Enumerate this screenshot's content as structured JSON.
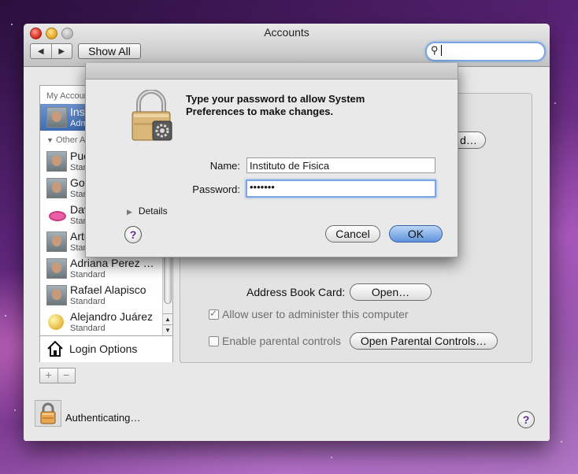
{
  "window": {
    "title": "Accounts"
  },
  "toolbar": {
    "back_icon": "◀",
    "forward_icon": "▶",
    "show_all_label": "Show All",
    "search_placeholder": ""
  },
  "sidebar": {
    "my_account_header": "My Account",
    "other_accounts_header": "Other Accou",
    "accounts": [
      {
        "name": "Instituto",
        "role": "Admin",
        "selected": true,
        "avatar": "face"
      },
      {
        "name": "Puente",
        "role": "Standard",
        "avatar": "face"
      },
      {
        "name": "Gomez",
        "role": "Standard",
        "avatar": "face"
      },
      {
        "name": "David B",
        "role": "Standard",
        "avatar": "lips"
      },
      {
        "name": "Arturo C",
        "role": "Standard",
        "avatar": "face"
      },
      {
        "name": "Adriana Perez …",
        "role": "Standard",
        "avatar": "face"
      },
      {
        "name": "Rafael Alapisco",
        "role": "Standard",
        "avatar": "face"
      },
      {
        "name": "Alejandro Juárez",
        "role": "Standard",
        "avatar": "ball"
      }
    ],
    "login_options_label": "Login Options",
    "add_label": "+",
    "remove_label": "−"
  },
  "main": {
    "partial_button_label": "d…",
    "address_book_label": "Address Book Card:",
    "open_button_label": "Open…",
    "allow_admin_label": "Allow user to administer this computer",
    "allow_admin_checked": true,
    "parental_label": "Enable parental controls",
    "parental_checked": false,
    "open_parental_label": "Open Parental Controls…"
  },
  "footer": {
    "auth_status": "Authenticating…",
    "help_label": "?"
  },
  "sheet": {
    "message": "Type your password to allow System Preferences to make changes.",
    "name_label": "Name:",
    "name_value": "Instituto de Fisica",
    "password_label": "Password:",
    "password_value": "•••••••",
    "details_label": "Details",
    "help_label": "?",
    "cancel_label": "Cancel",
    "ok_label": "OK"
  },
  "colors": {
    "selection_blue": "#3f6cb2",
    "focus_ring": "#7aa7e3",
    "help_mark": "#5d2b8e"
  }
}
